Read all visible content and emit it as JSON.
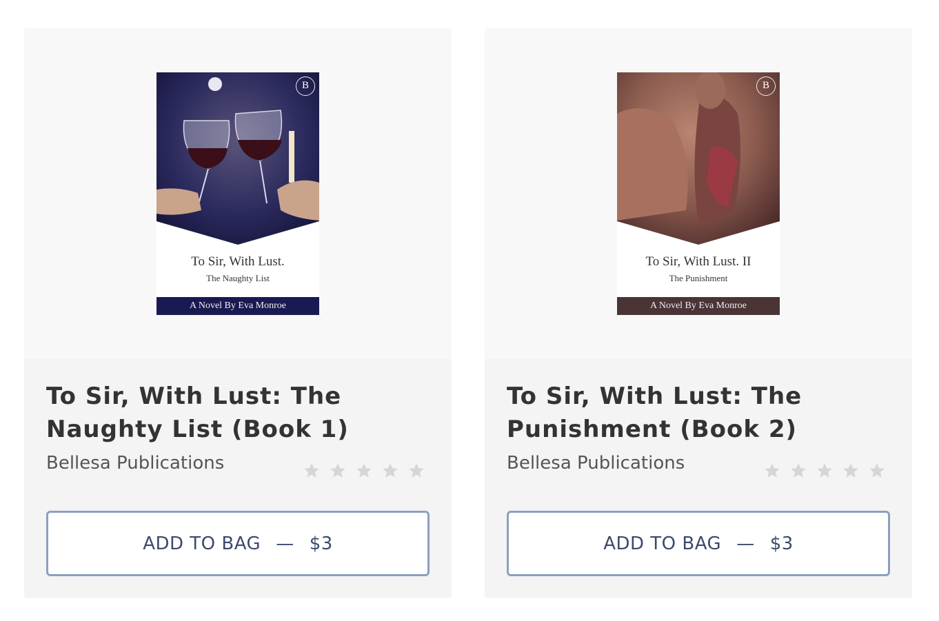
{
  "products": [
    {
      "title": "To Sir, With Lust: The Naughty List (Book 1)",
      "publisher": "Bellesa Publications",
      "rating_stars": 5,
      "rating_filled": 0,
      "button_label": "ADD TO BAG",
      "button_separator": "—",
      "price": "$3",
      "cover": {
        "title": "To Sir, With Lust.",
        "subtitle": "The Naughty List",
        "band_text": "A Novel By Eva Monroe",
        "badge": "B",
        "band_color": "#1a1a52",
        "image_color": "#2b2a5e"
      }
    },
    {
      "title": "To Sir, With Lust: The Punishment (Book 2)",
      "publisher": "Bellesa Publications",
      "rating_stars": 5,
      "rating_filled": 0,
      "button_label": "ADD TO BAG",
      "button_separator": "—",
      "price": "$3",
      "cover": {
        "title": "To Sir, With Lust. II",
        "subtitle": "The Punishment",
        "band_text": "A Novel By Eva Monroe",
        "badge": "B",
        "band_color": "#4a3436",
        "image_color": "#8a5a4e"
      }
    }
  ],
  "colors": {
    "card_bg": "#f4f4f4",
    "cover_area_bg": "#f8f8f8",
    "button_border": "#8aa0bf",
    "button_text": "#3b4a6b",
    "star_empty": "#d6d6d6"
  }
}
